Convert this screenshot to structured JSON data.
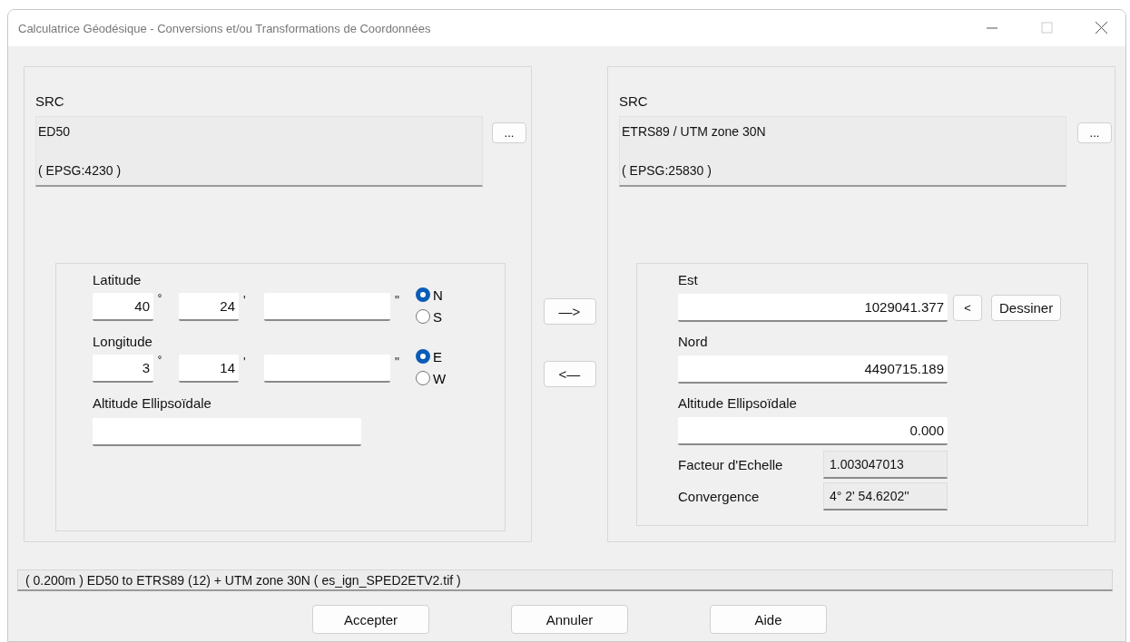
{
  "window": {
    "title": "Calculatrice Géodésique - Conversions et/ou Transformations de Coordonnées"
  },
  "source": {
    "crs_label": "SRC",
    "crs_name": "ED50",
    "crs_code": "( EPSG:4230 )",
    "browse_button": "...",
    "units": [
      "˚",
      "'",
      "\""
    ],
    "latitude": {
      "label": "Latitude",
      "degrees": "40",
      "minutes": "24",
      "hemispheres": [
        {
          "label": "N",
          "selected": true
        },
        {
          "label": "S",
          "selected": false
        }
      ]
    },
    "longitude": {
      "label": "Longitude",
      "degrees": "3",
      "minutes": "14",
      "hemispheres": [
        {
          "label": "E",
          "selected": true
        },
        {
          "label": "W",
          "selected": false
        }
      ]
    },
    "altitude": {
      "label": "Altitude Ellipsoïdale"
    }
  },
  "transfer_buttons": [
    "—>",
    "<—"
  ],
  "target": {
    "crs_label": "SRC",
    "crs_name": "ETRS89 / UTM zone 30N",
    "crs_code": "( EPSG:25830 )",
    "browse_button": "...",
    "east": {
      "label": "Est",
      "value": "1029041.377"
    },
    "pick_button": "<",
    "draw_button": "Dessiner",
    "north": {
      "label": "Nord",
      "value": "4490715.189"
    },
    "altitude": {
      "label": "Altitude Ellipsoïdale",
      "value": "0.000"
    },
    "scale_factor": {
      "label": "Facteur d'Echelle",
      "value": "1.003047013"
    },
    "convergence": {
      "label": "Convergence",
      "value": "4° 2' 54.6202''"
    }
  },
  "status": "( 0.200m ) ED50 to ETRS89 (12) + UTM zone 30N ( es_ign_SPED2ETV2.tif )",
  "buttons": [
    "Accepter",
    "Annuler",
    "Aide"
  ]
}
